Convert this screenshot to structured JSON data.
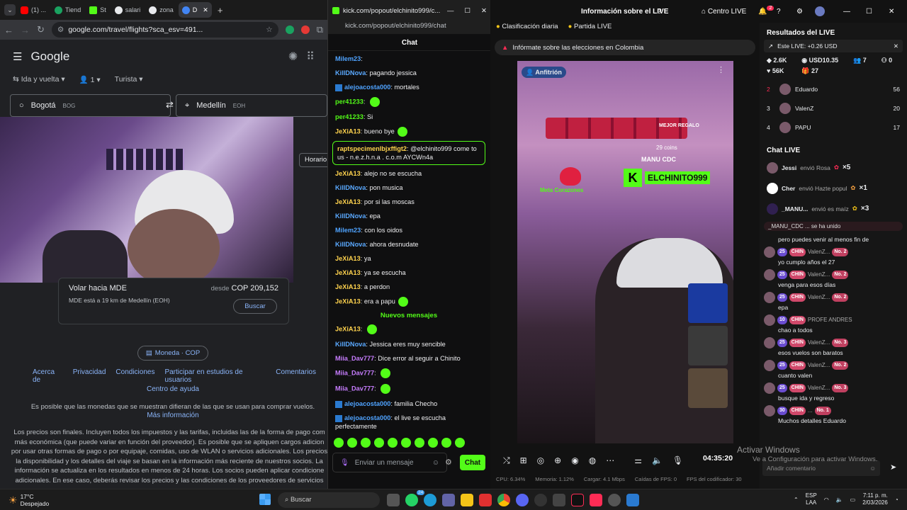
{
  "chrome": {
    "tabs": [
      {
        "label": "(1) ..."
      },
      {
        "label": "Tiend"
      },
      {
        "label": "St"
      },
      {
        "label": "salari"
      },
      {
        "label": "zona"
      },
      {
        "label": "D"
      }
    ],
    "url": "google.com/travel/flights?sca_esv=491...",
    "google_logo": "Google",
    "trip_type": "Ida y vuelta",
    "passengers": "1",
    "cabin": "Turista",
    "from_city": "Bogotá",
    "from_code": "BOG",
    "to_city": "Medellín",
    "to_code": "EOH",
    "horario": "Horario",
    "card": {
      "title": "Volar hacia MDE",
      "price_prefix": "desde",
      "price": "COP 209,152",
      "subtitle": "MDE está a 19 km de Medellín (EOH)",
      "button": "Buscar"
    },
    "currency": "Moneda · COP",
    "footer_links": [
      "Acerca de",
      "Privacidad",
      "Condiciones",
      "Participar en estudios de usuarios",
      "Comentarios"
    ],
    "help": "Centro de ayuda",
    "currency_note": "Es posible que las monedas que se muestran difieran de las que se usan para comprar vuelos.",
    "more_info": "Más información",
    "disclaimer": [
      "Los precios son finales. Incluyen todos los impuestos y las tarifas, incluidas las de la forma de pago com",
      "más económica (que puede variar en función del proveedor). Es posible que se apliquen cargos adicion",
      "por usar otras formas de pago o por equipaje, comidas, uso de WLAN o servicios adicionales. Los precios",
      "la disponibilidad y los detalles del viaje se basan en la información más reciente de nuestros socios. La",
      "información se actualiza en los resultados en menos de 24 horas. Los socios pueden aplicar condicione",
      "adicionales. En ese caso, deberás revisar los precios y las condiciones de los proveedores de servicios"
    ]
  },
  "popup": {
    "window_title": "kick.com/popout/elchinito999/c...",
    "url": "kick.com/popout/elchinito999/chat",
    "chat_title": "Chat",
    "messages": [
      {
        "user": "Milem23",
        "text": "",
        "color": "#4fa3ff",
        "partial": true
      },
      {
        "user": "KillDNova",
        "text": "pagando jessica",
        "color": "#5aa9ff"
      },
      {
        "user": "alejoacosta000",
        "text": "mortales",
        "color": "#4fa3ff",
        "badge": true
      },
      {
        "user": "per41233",
        "text": "",
        "color": "#53fc18",
        "emote": true
      },
      {
        "user": "per41233",
        "text": "Si",
        "color": "#53fc18"
      },
      {
        "user": "JeXiA13",
        "text": "bueno bye",
        "color": "#ffd34e",
        "emote": true
      },
      {
        "user": "raptspecimenlbjxffigt2",
        "text": "@elchinito999 come to us - n.e.z.h.n.a . c.o.m AYCWn4a",
        "color": "#ffd34e",
        "highlight": true
      },
      {
        "user": "JeXiA13",
        "text": "alejo no se escucha",
        "color": "#ffd34e"
      },
      {
        "user": "KillDNova",
        "text": "pon musica",
        "color": "#5aa9ff"
      },
      {
        "user": "JeXiA13",
        "text": "por si las moscas",
        "color": "#ffd34e"
      },
      {
        "user": "KillDNova",
        "text": "epa",
        "color": "#5aa9ff"
      },
      {
        "user": "Milem23",
        "text": "con los oidos",
        "color": "#4fa3ff"
      },
      {
        "user": "KillDNova",
        "text": "ahora desnudate",
        "color": "#5aa9ff"
      },
      {
        "user": "JeXiA13",
        "text": "ya",
        "color": "#ffd34e"
      },
      {
        "user": "JeXiA13",
        "text": "ya se escucha",
        "color": "#ffd34e"
      },
      {
        "user": "JeXiA13",
        "text": "a perdon",
        "color": "#ffd34e"
      },
      {
        "user": "JeXiA13",
        "text": "era a papu",
        "color": "#ffd34e",
        "emote": true
      }
    ],
    "new_messages": "Nuevos mensajes",
    "messages_new": [
      {
        "user": "JeXiA13",
        "text": "",
        "color": "#ffd34e",
        "emote": true
      },
      {
        "user": "KillDNova",
        "text": "Jessica eres muy sencible",
        "color": "#5aa9ff"
      },
      {
        "user": "Miia_Dav777",
        "text": "Dice error al seguir a Chinito",
        "color": "#c77dff"
      },
      {
        "user": "Miia_Dav777",
        "text": "",
        "color": "#c77dff",
        "emote": true
      },
      {
        "user": "Miia_Dav777",
        "text": "",
        "color": "#c77dff",
        "emote": true
      },
      {
        "user": "alejoacosta000",
        "text": "familia Checho",
        "color": "#4fa3ff",
        "badge": true
      },
      {
        "user": "alejoacosta000",
        "text": "el live se escucha perfectamente",
        "color": "#4fa3ff",
        "badge": true
      }
    ],
    "input_placeholder": "Enviar un mensaje",
    "send": "Chat"
  },
  "studio": {
    "title": "Información sobre el LIVE",
    "centro": "Centro LIVE",
    "notif_count": "2",
    "tab_daily": "Clasificación diaria",
    "tab_party": "Partida LIVE",
    "banner": "Infórmate sobre las elecciones en Colombia",
    "host_badge": "Anfitrión",
    "overlay_name": "ELCHINITO999",
    "overlay_user": "MANU CDC",
    "overlay_coins": "29 coins",
    "overlay_best": "MEJOR REGALO",
    "overlay_meta": "Meta Corazones",
    "timer": "04:35:20",
    "stats": [
      "CPU: 6.34%",
      "Memoria: 1.12%",
      "Cargar: 4.1 Mbps",
      "Caídas de FPS: 0",
      "FPS del codificador: 30"
    ],
    "results_title": "Resultados del LIVE",
    "live_delta": "Este LIVE: +0.26 USD",
    "kpis": [
      "2.6K",
      "USD10.35",
      "7",
      "0",
      "56K",
      "27"
    ],
    "ranking": [
      {
        "rank": "2",
        "name": "Eduardo",
        "score": "56"
      },
      {
        "rank": "3",
        "name": "ValenZ",
        "score": "20"
      },
      {
        "rank": "4",
        "name": "PAPU",
        "score": "17"
      }
    ],
    "chat_title": "Chat LIVE",
    "gifts": [
      {
        "user": "Jessi",
        "action": "envió Rosa",
        "count": "×5"
      },
      {
        "user": "Cher",
        "action": "envió Hazte popul",
        "count": "×1"
      },
      {
        "user": "_MANU...",
        "action": "envió es maíz",
        "count": "×3"
      }
    ],
    "joined": "_MANU_CDC ... se ha unido",
    "chat": [
      {
        "text": "pero puedes venir al menos fin de",
        "badges": false
      },
      {
        "lvl": "25",
        "club": "CHIN",
        "name": "ValenZ...",
        "no": "No. 2",
        "text": "yo cumplo años el 27"
      },
      {
        "lvl": "25",
        "club": "CHIN",
        "name": "ValenZ...",
        "no": "No. 2",
        "text": "venga para esos días"
      },
      {
        "lvl": "25",
        "club": "CHIN",
        "name": "ValenZ...",
        "no": "No. 2",
        "text": "epa"
      },
      {
        "lvl": "10",
        "club": "CHIN",
        "name": "PROFE ANDRES",
        "no": "",
        "text": "chao a todos"
      },
      {
        "lvl": "25",
        "club": "CHIN",
        "name": "ValenZ...",
        "no": "No. 3",
        "text": "esos vuelos son baratos"
      },
      {
        "lvl": "25",
        "club": "CHIN",
        "name": "ValenZ...",
        "no": "No. 2",
        "text": "cuanto valen"
      },
      {
        "lvl": "25",
        "club": "CHIN",
        "name": "ValenZ...",
        "no": "No. 3",
        "text": "busque ida y regreso"
      },
      {
        "lvl": "30",
        "club": "CHIN",
        "name": "...",
        "no": "No. 1",
        "text": "Muchos detalles Eduardo"
      }
    ],
    "comment_placeholder": "Añadir comentario",
    "watermark": "Activar Windows",
    "watermark_sub": "Ve a Configuración para activar Windows."
  },
  "taskbar": {
    "temp": "17°C",
    "weather": "Despejado",
    "search": "Buscar",
    "lang": "ESP",
    "lang2": "LAA",
    "time": "7:11 p. m.",
    "date": "2/03/2026",
    "badge_whatsapp": "24"
  },
  "colors": {
    "kick_green": "#53fc18",
    "tiktok_pink": "#fe2c55"
  }
}
